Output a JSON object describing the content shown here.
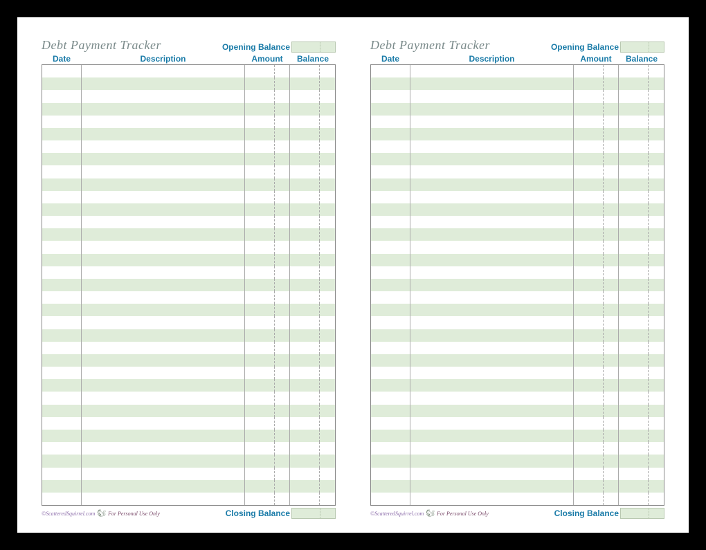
{
  "tracker": {
    "title": "Debt Payment Tracker",
    "opening_label": "Opening Balance",
    "closing_label": "Closing Balance",
    "columns": {
      "date": "Date",
      "description": "Description",
      "amount": "Amount",
      "balance": "Balance"
    },
    "row_count": 35,
    "credit_site": "©ScatteredSquirrel.com",
    "credit_note": "For Personal Use Only"
  }
}
